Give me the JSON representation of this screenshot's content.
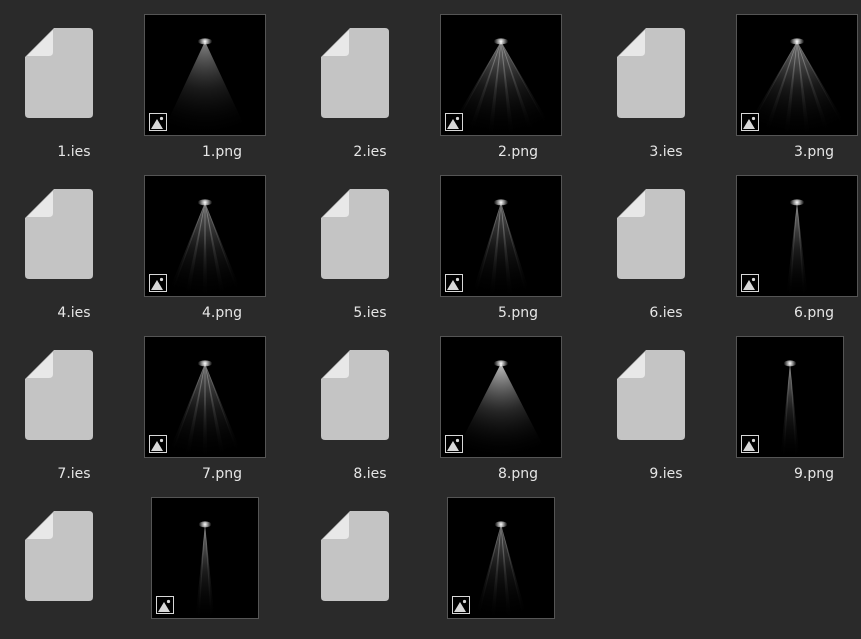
{
  "files": [
    {
      "name": "1.ies",
      "kind": "ies"
    },
    {
      "name": "1.png",
      "kind": "png",
      "preview": "wide-soft"
    },
    {
      "name": "2.ies",
      "kind": "ies"
    },
    {
      "name": "2.png",
      "kind": "png",
      "preview": "wide-rays"
    },
    {
      "name": "3.ies",
      "kind": "ies"
    },
    {
      "name": "3.png",
      "kind": "png",
      "preview": "wide-rays"
    },
    {
      "name": "4.ies",
      "kind": "ies"
    },
    {
      "name": "4.png",
      "kind": "png",
      "preview": "medium-rays"
    },
    {
      "name": "5.ies",
      "kind": "ies"
    },
    {
      "name": "5.png",
      "kind": "png",
      "preview": "narrow-rays"
    },
    {
      "name": "6.ies",
      "kind": "ies"
    },
    {
      "name": "6.png",
      "kind": "png",
      "preview": "narrow-beam"
    },
    {
      "name": "7.ies",
      "kind": "ies"
    },
    {
      "name": "7.png",
      "kind": "png",
      "preview": "medium-rays"
    },
    {
      "name": "8.ies",
      "kind": "ies"
    },
    {
      "name": "8.png",
      "kind": "png",
      "preview": "cone-solid"
    },
    {
      "name": "9.ies",
      "kind": "ies"
    },
    {
      "name": "9.png",
      "kind": "png",
      "preview": "narrow-beam"
    },
    {
      "name": "",
      "kind": "ies"
    },
    {
      "name": "",
      "kind": "png",
      "preview": "narrow-beam"
    },
    {
      "name": "",
      "kind": "ies"
    },
    {
      "name": "",
      "kind": "png",
      "preview": "narrow-rays"
    }
  ],
  "colors": {
    "background": "#2a2a2a",
    "document_icon": "#c4c4c4",
    "document_fold": "#e8e8e8",
    "label_text": "#e6e6e6"
  },
  "icons": {
    "ies": "document-icon",
    "png_badge": "image-badge-icon"
  }
}
